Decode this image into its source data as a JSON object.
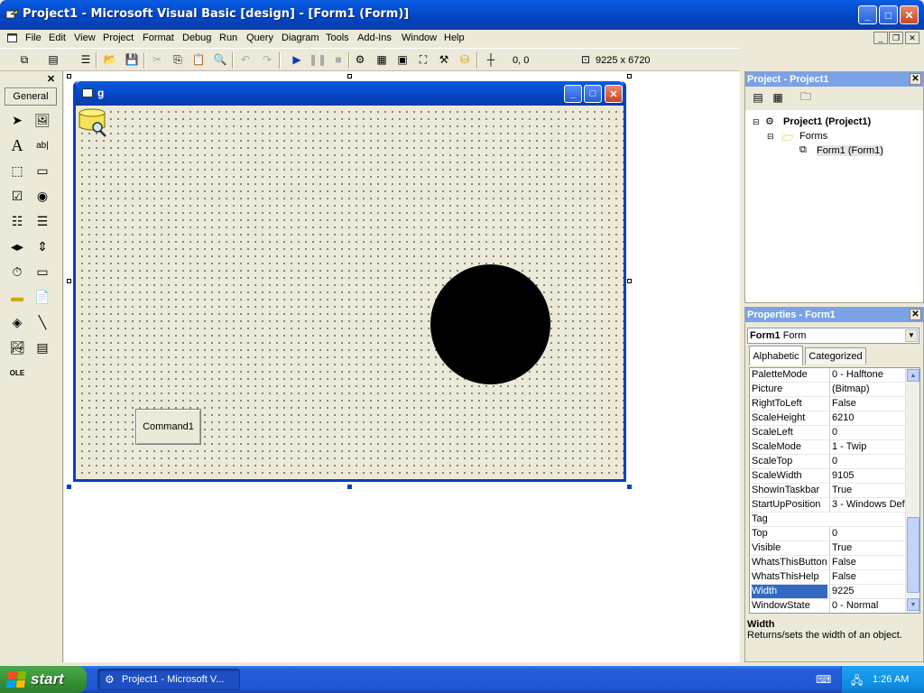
{
  "window": {
    "title": "Project1 - Microsoft Visual Basic [design] - [Form1 (Form)]"
  },
  "menu": [
    "File",
    "Edit",
    "View",
    "Project",
    "Format",
    "Debug",
    "Run",
    "Query",
    "Diagram",
    "Tools",
    "Add-Ins",
    "Window",
    "Help"
  ],
  "toolbar": {
    "position": "0, 0",
    "size": "9225 x 6720"
  },
  "toolbox": {
    "tab": "General"
  },
  "form": {
    "caption": "g",
    "button_caption": "Command1"
  },
  "project": {
    "title": "Project - Project1",
    "root": "Project1 (Project1)",
    "folder": "Forms",
    "item": "Form1 (Form1)"
  },
  "properties": {
    "title": "Properties - Form1",
    "object_name": "Form1",
    "object_type": "Form",
    "tabs": [
      "Alphabetic",
      "Categorized"
    ],
    "rows": [
      {
        "name": "PaletteMode",
        "value": "0 - Halftone"
      },
      {
        "name": "Picture",
        "value": "(Bitmap)"
      },
      {
        "name": "RightToLeft",
        "value": "False"
      },
      {
        "name": "ScaleHeight",
        "value": "6210"
      },
      {
        "name": "ScaleLeft",
        "value": "0"
      },
      {
        "name": "ScaleMode",
        "value": "1 - Twip"
      },
      {
        "name": "ScaleTop",
        "value": "0"
      },
      {
        "name": "ScaleWidth",
        "value": "9105"
      },
      {
        "name": "ShowInTaskbar",
        "value": "True"
      },
      {
        "name": "StartUpPosition",
        "value": "3 - Windows Def"
      },
      {
        "name": "Tag",
        "value": ""
      },
      {
        "name": "Top",
        "value": "0"
      },
      {
        "name": "Visible",
        "value": "True"
      },
      {
        "name": "WhatsThisButton",
        "value": "False"
      },
      {
        "name": "WhatsThisHelp",
        "value": "False"
      },
      {
        "name": "Width",
        "value": "9225"
      },
      {
        "name": "WindowState",
        "value": "0 - Normal"
      }
    ],
    "selected_row": "Width",
    "description_title": "Width",
    "description_text": "Returns/sets the width of an object."
  },
  "taskbar": {
    "start_label": "start",
    "task_label": "Project1 - Microsoft V...",
    "clock": "1:26 AM"
  }
}
